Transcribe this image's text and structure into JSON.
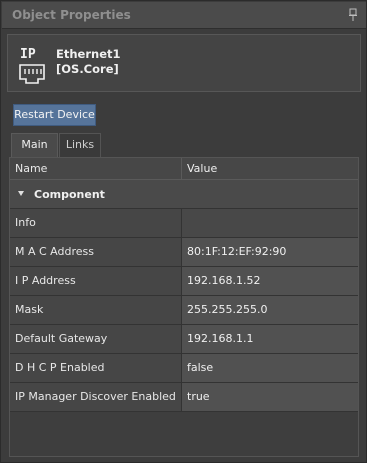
{
  "panel": {
    "title": "Object Properties"
  },
  "device": {
    "icon_text": "IP",
    "name": "Ethernet1",
    "subtitle": "[OS.Core]"
  },
  "actions": {
    "restart_label": "Restart Device"
  },
  "tabs": [
    {
      "label": "Main",
      "active": true
    },
    {
      "label": "Links",
      "active": false
    }
  ],
  "grid": {
    "columns": [
      "Name",
      "Value"
    ],
    "category": "Component",
    "rows": [
      {
        "name": "Info",
        "value": ""
      },
      {
        "name": "M A C Address",
        "value": "80:1F:12:EF:92:90"
      },
      {
        "name": "I P Address",
        "value": "192.168.1.52"
      },
      {
        "name": "Mask",
        "value": "255.255.255.0"
      },
      {
        "name": "Default Gateway",
        "value": "192.168.1.1"
      },
      {
        "name": "D H C P Enabled",
        "value": "false"
      },
      {
        "name": "IP Manager Discover Enabled",
        "value": "true"
      }
    ]
  }
}
